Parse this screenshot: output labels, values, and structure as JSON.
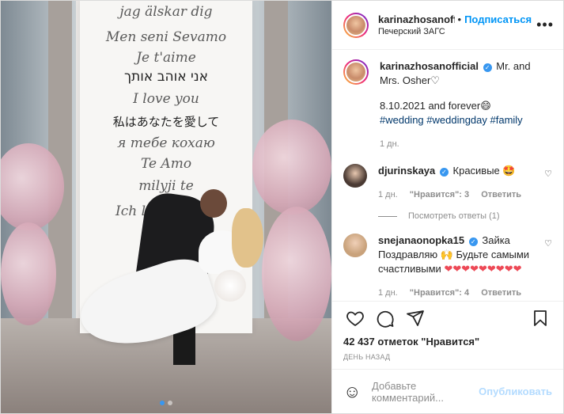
{
  "header": {
    "username": "karinazhosanofficial",
    "follow_label": "Подписаться",
    "location": "Печерский ЗАГС",
    "more": "•••"
  },
  "banner": {
    "lines": [
      "jag älskar dig",
      "Men seni Sevamo",
      "Je t'aime",
      "אני אוהב אותך",
      "I love you",
      "私はあなたを愛して",
      "я тебе кохаю",
      "Te Amo",
      "milyji te",
      "Ich lie"
    ]
  },
  "caption": {
    "username": "karinazhosanofficial",
    "text": "Mr. and Mrs. Osher♡",
    "date_line": "8.10.2021 and forever😄",
    "tags": "#wedding #weddingday #family",
    "time": "1 дн."
  },
  "comments": [
    {
      "username": "djurinskaya",
      "text": "Красивые 🤩",
      "time": "1 дн.",
      "likes": "\"Нравится\": 3",
      "reply": "Ответить",
      "view_replies": "Посмотреть ответы (1)"
    },
    {
      "username": "snejanaonopka15",
      "text": "Зайка Поздравляю 🙌 Будьте самыми счастливыми",
      "hearts": "❤❤❤❤❤❤❤❤❤",
      "time": "1 дн.",
      "likes": "\"Нравится\": 4",
      "reply": "Ответить"
    }
  ],
  "likes_text": "42 437 отметок \"Нравится\"",
  "time_ago": "ДЕНЬ НАЗАД",
  "add_comment": {
    "placeholder": "Добавьте комментарий...",
    "publish": "Опубликовать"
  },
  "icons": {
    "like": "heart-icon",
    "comment": "comment-icon",
    "share": "paper-plane-icon",
    "save": "bookmark-icon",
    "emoji": "smiley-icon"
  }
}
